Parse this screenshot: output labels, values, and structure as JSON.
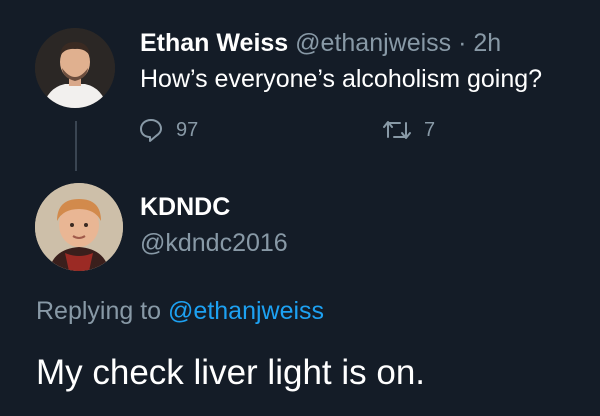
{
  "tweet": {
    "author_name": "Ethan Weiss",
    "author_handle": "@ethanjweiss",
    "separator": "·",
    "time": "2h",
    "text": "How’s everyone’s alcoholism going?",
    "reply_count": "97",
    "retweet_count": "7"
  },
  "reply": {
    "author_name": "KDNDC",
    "author_handle": "@kdndc2016",
    "replying_prefix": "Replying to",
    "replying_to": "@ethanjweiss",
    "text": "My check liver light is on."
  },
  "colors": {
    "background": "#141c27",
    "muted": "#8899a6",
    "link": "#1da1f2",
    "text": "#ffffff"
  },
  "icons": [
    "reply-icon",
    "retweet-icon"
  ]
}
